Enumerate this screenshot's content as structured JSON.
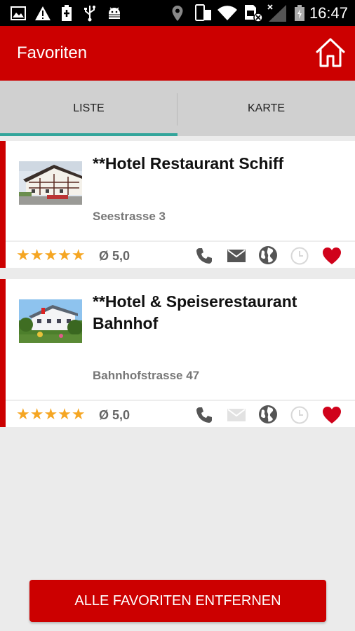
{
  "status_bar": {
    "time": "16:47",
    "icons": [
      "image-icon",
      "warning-icon",
      "battery-saver-icon",
      "usb-icon",
      "android-debug-icon",
      "location-icon",
      "phone-rotate-icon",
      "wifi-icon",
      "sim-icon",
      "signal-icon",
      "battery-icon"
    ]
  },
  "app_bar": {
    "title": "Favoriten",
    "home_icon": "home-icon",
    "color": "#cc0000"
  },
  "tabs": [
    {
      "label": "LISTE",
      "active": true
    },
    {
      "label": "KARTE",
      "active": false
    }
  ],
  "favorites": [
    {
      "name": "**Hotel Restaurant Schiff",
      "address": "Seestrasse 3",
      "stars": "★★★★★",
      "rating": "Ø 5,0",
      "actions": {
        "phone": true,
        "email": true,
        "web": true,
        "hours": false,
        "favorite": true
      }
    },
    {
      "name": "**Hotel & Speiserestaurant Bahnhof",
      "address": "Bahnhofstrasse 47",
      "stars": "★★★★★",
      "rating": "Ø 5,0",
      "actions": {
        "phone": true,
        "email": false,
        "web": true,
        "hours": false,
        "favorite": true
      }
    }
  ],
  "remove_all_button": "ALLE FAVORITEN ENTFERNEN",
  "colors": {
    "accent": "#cc0000",
    "star": "#f5a623",
    "tab_indicator": "#33a59b",
    "icon_active": "#555555",
    "icon_disabled": "#d8d8d8",
    "heart": "#d0021b"
  }
}
